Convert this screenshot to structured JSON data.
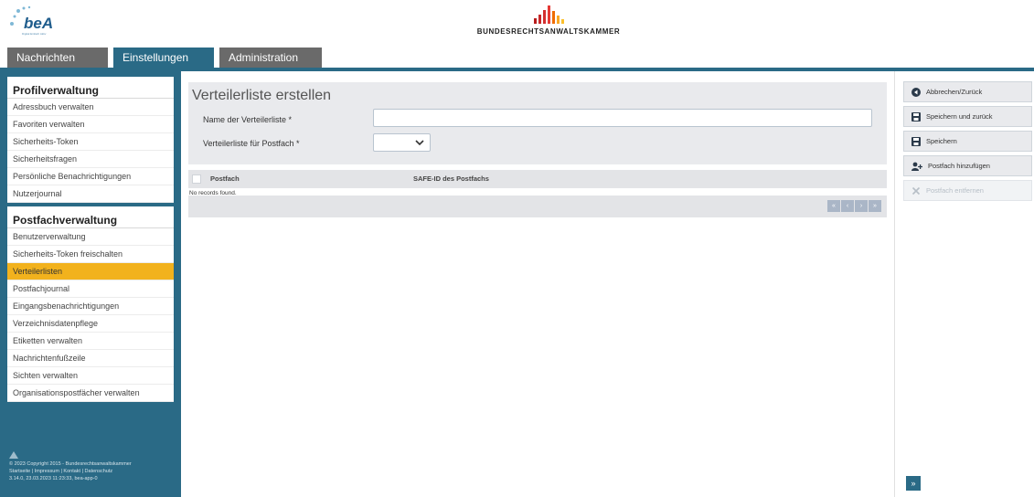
{
  "header": {
    "logo_text": "beA",
    "logo_tagline": "Digital Einfach Aktiv",
    "brak_title": "BUNDESRECHTSANWALTSKAMMER"
  },
  "tabs": [
    {
      "label": "Nachrichten"
    },
    {
      "label": "Einstellungen"
    },
    {
      "label": "Administration"
    }
  ],
  "sidebar": {
    "profil": {
      "title": "Profilverwaltung",
      "items": [
        "Adressbuch verwalten",
        "Favoriten verwalten",
        "Sicherheits-Token",
        "Sicherheitsfragen",
        "Persönliche Benachrichtigungen",
        "Nutzerjournal"
      ]
    },
    "postfach": {
      "title": "Postfachverwaltung",
      "items": [
        "Benutzerverwaltung",
        "Sicherheits-Token freischalten",
        "Verteilerlisten",
        "Postfachjournal",
        "Eingangsbenachrichtigungen",
        "Verzeichnisdatenpflege",
        "Etiketten verwalten",
        "Nachrichtenfußzeile",
        "Sichten verwalten",
        "Organisationspostfächer verwalten"
      ],
      "active_index": 2
    },
    "footer": {
      "copyright": "© 2023 Copyright 2015 - Bundesrechtsanwaltskammer",
      "links": "Startseite | Impressum | Kontakt | Datenschutz",
      "version": "3.14.0, 23.03.2023 11:23:33, bea-app-0"
    }
  },
  "form": {
    "title": "Verteilerliste erstellen",
    "name_label": "Name der Verteilerliste *",
    "name_value": "",
    "postfach_label": "Verteilerliste für Postfach *",
    "postfach_value": ""
  },
  "table": {
    "columns": [
      "Postfach",
      "SAFE-ID des Postfachs"
    ],
    "empty_text": "No records found."
  },
  "pager": [
    "«",
    "‹",
    "›",
    "»"
  ],
  "actions": [
    {
      "label": "Abbrechen/Zurück",
      "icon": "back-circle-icon",
      "enabled": true
    },
    {
      "label": "Speichern und zurück",
      "icon": "save-icon",
      "enabled": true
    },
    {
      "label": "Speichern",
      "icon": "save-icon",
      "enabled": true
    },
    {
      "label": "Postfach hinzufügen",
      "icon": "add-user-icon",
      "enabled": true
    },
    {
      "label": "Postfach entfernen",
      "icon": "close-icon",
      "enabled": false
    }
  ],
  "collapse_label": "»",
  "colors": {
    "primary": "#2a6a86",
    "active_item": "#f2b21d",
    "tab_grey": "#6a6a6a"
  }
}
